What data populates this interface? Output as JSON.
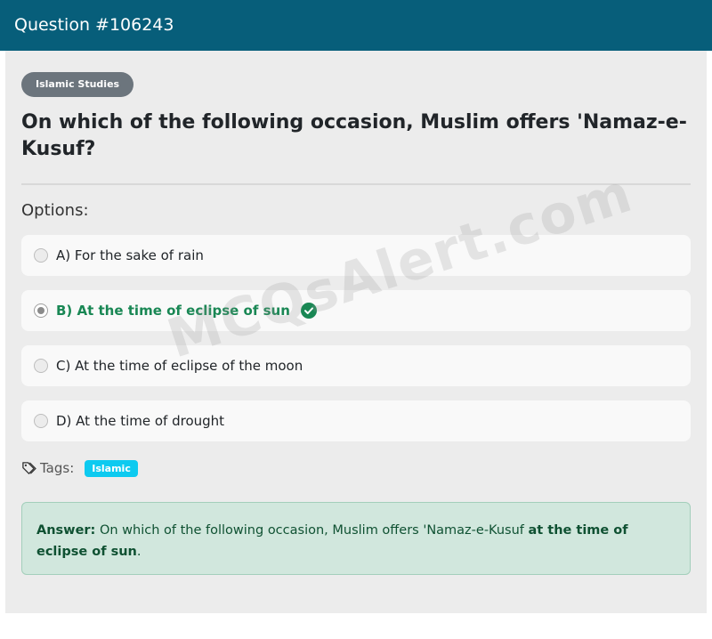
{
  "header": {
    "title": "Question #106243"
  },
  "category": {
    "label": "Islamic Studies"
  },
  "question": {
    "text": "On which of the following occasion, Muslim offers 'Namaz-e-Kusuf?"
  },
  "options_title": "Options:",
  "options": [
    {
      "label": "A) For the sake of rain",
      "selected": false,
      "correct": false
    },
    {
      "label": "B) At the time of eclipse of sun",
      "selected": true,
      "correct": true
    },
    {
      "label": "C) At the time of eclipse of the moon",
      "selected": false,
      "correct": false
    },
    {
      "label": "D) At the time of drought",
      "selected": false,
      "correct": false
    }
  ],
  "tags": {
    "label": "Tags:",
    "items": [
      "Islamic"
    ]
  },
  "answer": {
    "prefix": "Answer:",
    "text": " On which of the following occasion, Muslim offers 'Namaz-e-Kusuf ",
    "highlight": "at the time of eclipse of sun",
    "suffix": "."
  },
  "watermark": {
    "text": "MCQsAlert.com"
  },
  "colors": {
    "header_bg": "#075e7a",
    "correct": "#198754",
    "tag_pill": "#0dcaf0",
    "answer_bg": "#d1e7dd"
  }
}
